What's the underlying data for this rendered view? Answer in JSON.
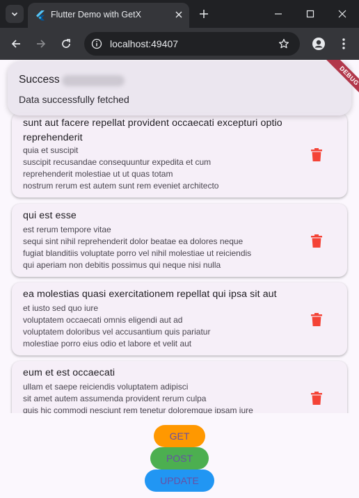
{
  "browser": {
    "tab_title": "Flutter Demo with GetX",
    "url": "localhost:49407",
    "colors": {
      "frame": "#202124",
      "toolbar": "#35363a",
      "text": "#e8eaed"
    }
  },
  "snackbar": {
    "title": "Success",
    "message": "Data successfully fetched"
  },
  "debug_banner": "DEBUG",
  "posts": [
    {
      "title": "sunt aut facere repellat provident occaecati excepturi optio reprehenderit",
      "body": "quia et suscipit\nsuscipit recusandae consequuntur expedita et cum\nreprehenderit molestiae ut ut quas totam\nnostrum rerum est autem sunt rem eveniet architecto"
    },
    {
      "title": "qui est esse",
      "body": "est rerum tempore vitae\nsequi sint nihil reprehenderit dolor beatae ea dolores neque\nfugiat blanditiis voluptate porro vel nihil molestiae ut reiciendis\nqui aperiam non debitis possimus qui neque nisi nulla"
    },
    {
      "title": "ea molestias quasi exercitationem repellat qui ipsa sit aut",
      "body": "et iusto sed quo iure\nvoluptatem occaecati omnis eligendi aut ad\nvoluptatem doloribus vel accusantium quis pariatur\nmolestiae porro eius odio et labore et velit aut"
    },
    {
      "title": "eum et est occaecati",
      "body": "ullam et saepe reiciendis voluptatem adipisci\nsit amet autem assumenda provident rerum culpa\nquis hic commodi nesciunt rem tenetur doloremque ipsam iure"
    }
  ],
  "buttons": {
    "get": "GET",
    "post": "POST",
    "update": "UPDATE"
  },
  "colors": {
    "get_bg": "#ff9800",
    "post_bg": "#4caf50",
    "update_bg": "#2196f3",
    "button_text": "#6750a4",
    "delete_icon": "#f44336",
    "card_bg": "#f6eff8"
  },
  "icons": {
    "delete": "trash-icon",
    "back": "arrow-left-icon",
    "forward": "arrow-right-icon",
    "reload": "reload-icon",
    "bookmark": "star-icon",
    "profile": "profile-icon",
    "menu": "kebab-menu-icon"
  }
}
